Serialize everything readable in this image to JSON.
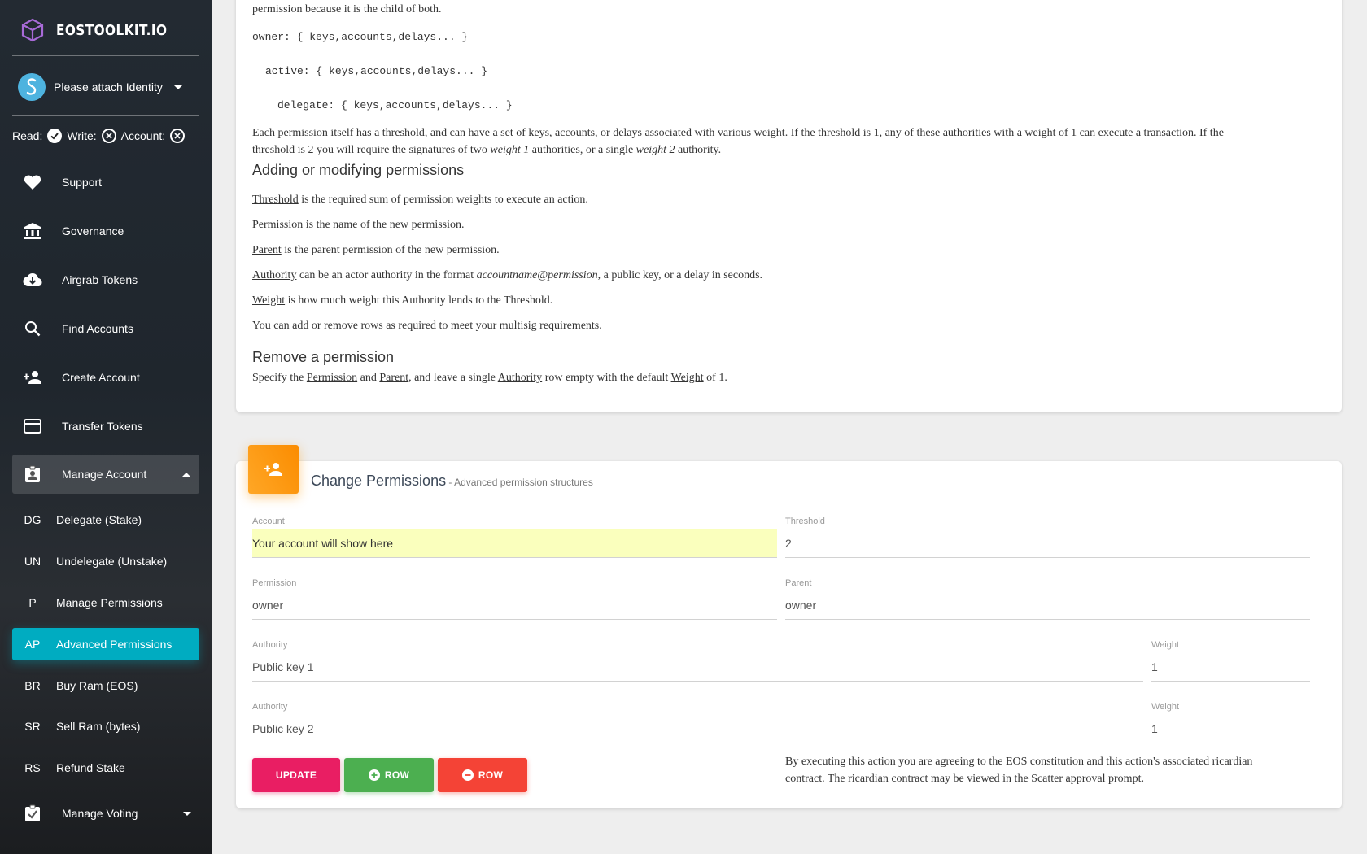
{
  "brand": {
    "name": "EOSTOOLKIT.IO"
  },
  "identity": {
    "label": "Please attach Identity"
  },
  "permissions_status": {
    "read": "Read:",
    "write": "Write:",
    "account": "Account:"
  },
  "nav": {
    "support": "Support",
    "governance": "Governance",
    "airgrab": "Airgrab Tokens",
    "find": "Find Accounts",
    "create": "Create Account",
    "transfer": "Transfer Tokens",
    "manage": "Manage Account",
    "voting": "Manage Voting"
  },
  "submenu": [
    {
      "abbr": "DG",
      "label": "Delegate (Stake)"
    },
    {
      "abbr": "UN",
      "label": "Undelegate (Unstake)"
    },
    {
      "abbr": "P",
      "label": "Manage Permissions"
    },
    {
      "abbr": "AP",
      "label": "Advanced Permissions"
    },
    {
      "abbr": "BR",
      "label": "Buy Ram (EOS)"
    },
    {
      "abbr": "SR",
      "label": "Sell Ram (bytes)"
    },
    {
      "abbr": "RS",
      "label": "Refund Stake"
    }
  ],
  "docs": {
    "line0": "permission because it is the child of both.",
    "code1": "owner: { keys,accounts,delays... }",
    "code2": "active: { keys,accounts,delays... }",
    "code3": "delegate: { keys,accounts,delays... }",
    "para1a": "Each permission itself has a threshold, and can have a set of keys, accounts, or delays associated with various weight. If the threshold is 1, any of these authorities with a weight of 1 can execute a transaction. If the",
    "para1b_1": "threshold is 2 you will require the signatures of two ",
    "para1b_em1": "weight 1",
    "para1b_2": " authorities, or a single ",
    "para1b_em2": "weight 2",
    "para1b_3": " authority.",
    "h_adding": "Adding or modifying permissions",
    "t_threshold": "Threshold",
    "d_threshold": " is the required sum of permission weights to execute an action.",
    "t_permission": "Permission",
    "d_permission": " is the name of the new permission.",
    "t_parent": "Parent",
    "d_parent": " is the parent permission of the new permission.",
    "t_authority": "Authority",
    "d_authority1": " can be an actor authority in the format ",
    "d_authority_em": "accountname@permission",
    "d_authority2": ", a public key, or a delay in seconds.",
    "t_weight": "Weight",
    "d_weight": " is how much weight this Authority lends to the Threshold.",
    "rows_note": "You can add or remove rows as required to meet your multisig requirements.",
    "h_remove": "Remove a permission",
    "rm_1": "Specify the ",
    "rm_perm": "Permission",
    "rm_2": " and ",
    "rm_parent": "Parent",
    "rm_3": ", and leave a single ",
    "rm_auth": "Authority",
    "rm_4": " row empty with the default ",
    "rm_weight": "Weight",
    "rm_5": " of 1."
  },
  "form": {
    "title": "Change Permissions",
    "subtitle": " - Advanced permission structures",
    "account_label": "Account",
    "account_value": "Your account will show here",
    "threshold_label": "Threshold",
    "threshold_value": "2",
    "permission_label": "Permission",
    "permission_value": "owner",
    "parent_label": "Parent",
    "parent_value": "owner",
    "authorities": [
      {
        "label": "Authority",
        "value": "Public key 1",
        "weight_label": "Weight",
        "weight": "1"
      },
      {
        "label": "Authority",
        "value": "Public key 2",
        "weight_label": "Weight",
        "weight": "1"
      }
    ],
    "update_label": "UPDATE",
    "add_row_label": "ROW",
    "remove_row_label": "ROW",
    "disclaimer1": "By executing this action you are agreeing to the EOS constitution and this action's associated ricardian",
    "disclaimer2": "contract. The ricardian contract may be viewed in the Scatter approval prompt."
  },
  "colors": {
    "accent": "#00acc1",
    "update": "#e91e63",
    "add": "#4caf50",
    "remove": "#f44336",
    "card_icon": "#ff9800"
  }
}
